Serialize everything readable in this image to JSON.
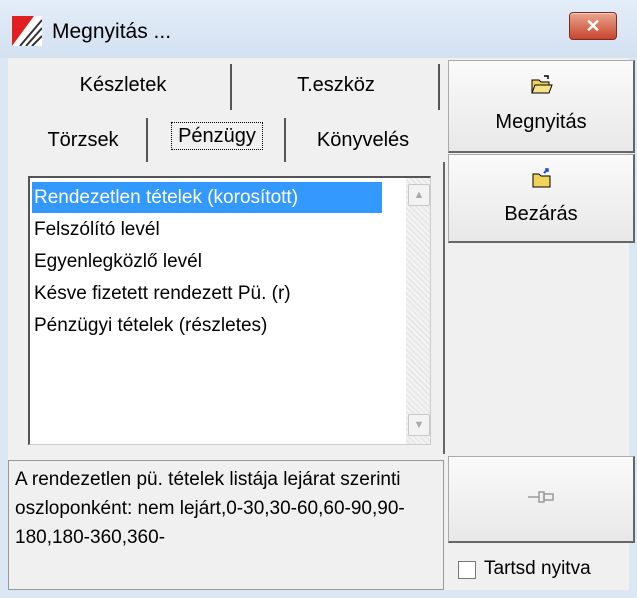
{
  "window": {
    "title": "Megnyitás ..."
  },
  "tabs": {
    "row1": [
      "Készletek",
      "T.eszköz"
    ],
    "row2": [
      "Törzsek",
      "Pénzügy",
      "Könyvelés"
    ],
    "active": "Pénzügy"
  },
  "list": {
    "items": [
      "Rendezetlen tételek (korosított)",
      "Felszólító levél",
      "Egyenlegközlő levél",
      "Késve fizetett rendezett Pü. (r)",
      "Pénzügyi tételek (részletes)"
    ],
    "selected_index": 0
  },
  "description": "A rendezetlen pü. tételek listája lejárat szerinti oszloponként: nem lejárt,0-30,30-60,60-90,90-180,180-360,360-",
  "buttons": {
    "open": {
      "label": "Megnyitás",
      "icon": "open-folder-icon"
    },
    "close": {
      "label": "Bezárás",
      "icon": "close-folder-icon"
    },
    "pin": {
      "icon": "pin-icon"
    }
  },
  "keep_open": {
    "label": "Tartsd nyitva",
    "checked": false
  }
}
